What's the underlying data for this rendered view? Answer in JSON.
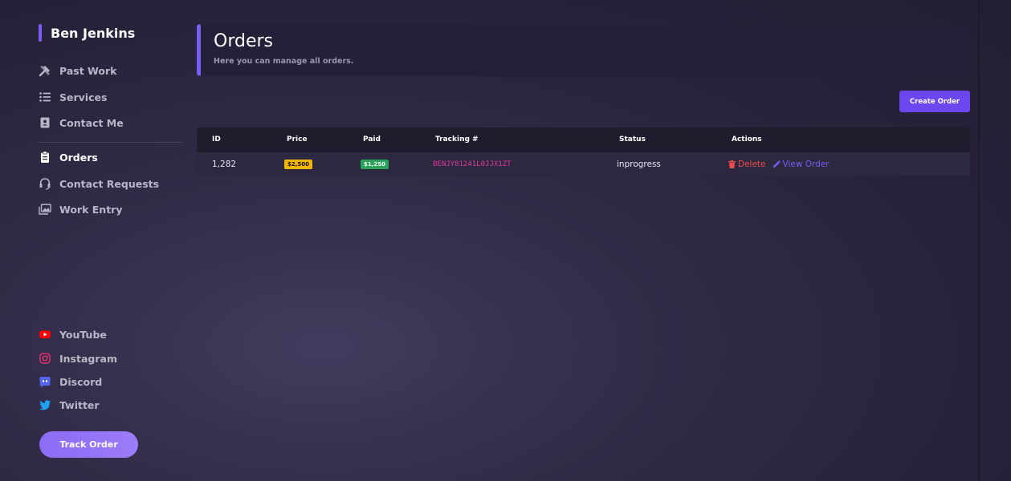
{
  "sidebar": {
    "brand": "Ben Jenkins",
    "nav": [
      {
        "label": "Past Work",
        "icon": "tools-icon"
      },
      {
        "label": "Services",
        "icon": "list-icon"
      },
      {
        "label": "Contact Me",
        "icon": "contact-book-icon"
      },
      {
        "label": "Orders",
        "icon": "clipboard-icon",
        "active": true
      },
      {
        "label": "Contact Requests",
        "icon": "headset-icon"
      },
      {
        "label": "Work Entry",
        "icon": "images-icon"
      }
    ],
    "social": [
      {
        "label": "YouTube",
        "icon": "youtube-icon",
        "color": "#ff0000"
      },
      {
        "label": "Instagram",
        "icon": "instagram-icon",
        "color": "#e1306c"
      },
      {
        "label": "Discord",
        "icon": "discord-icon",
        "color": "#5865f2"
      },
      {
        "label": "Twitter",
        "icon": "twitter-icon",
        "color": "#1da1f2"
      }
    ],
    "track_order_label": "Track Order"
  },
  "header": {
    "title": "Orders",
    "subtitle": "Here you can manage all orders."
  },
  "create_order_label": "Create Order",
  "table": {
    "columns": [
      "ID",
      "Price",
      "Paid",
      "Tracking #",
      "Status",
      "Actions"
    ],
    "rows": [
      {
        "id": "1,282",
        "price": "$2,500",
        "paid": "$1,250",
        "tracking": "BENJY81241L0JJX1ZT",
        "status": "inprogress",
        "delete_label": "Delete",
        "view_label": "View Order"
      }
    ]
  },
  "colors": {
    "accent": "#7b5cf5",
    "button": "#6c47f0",
    "price_badge": "#f2b705",
    "paid_badge": "#27a35a",
    "tracking": "#e0389a",
    "delete": "#ef4b4b"
  }
}
